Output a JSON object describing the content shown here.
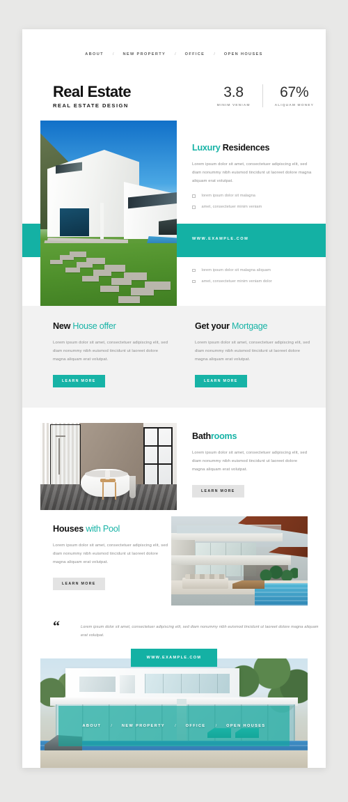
{
  "theme": {
    "accent": "#17b3a6",
    "accent_band": "#14b1a4",
    "page_bg": "#e8e8e7",
    "band_bg": "#f2f2f2",
    "text_dark": "#111111",
    "text_muted": "#8b8b8b"
  },
  "top_nav": {
    "items": [
      "ABOUT",
      "NEW PROPERTY",
      "OFFICE",
      "OPEN HOUSES"
    ],
    "separator": "/"
  },
  "brand": {
    "title": "Real Estate",
    "subtitle": "REAL ESTATE DESIGN"
  },
  "stats": [
    {
      "value": "3.8",
      "label": "MINIM VENIAM"
    },
    {
      "value": "67%",
      "label": "ALIQUAM MONEY"
    }
  ],
  "hero": {
    "heading_accent": "Luxury",
    "heading_rest": " Residences",
    "body": "Lorem ipsum dolor sit amet, consectetuer adipiscing elit, sed diam nonummy nibh euismod tincidunt ut laoreet dolore magna aliquam erat volutpat.",
    "bullets": [
      "lorem ipsum dolor sit malagna",
      "amet, consectetuer minim veniam"
    ],
    "image_alt": "modern-white-villa-with-lawn"
  },
  "teal_band": {
    "url": "WWW.EXAMPLE.COM"
  },
  "hero_list_2": {
    "bullets": [
      "lorem ipsum dolor sit malagna aliquam",
      "amet, consectetuer minim veniam dolor"
    ]
  },
  "offers": [
    {
      "heading_dark": "New",
      "heading_accent": " House offer",
      "body": "Lorem ipsum dolor sit amet, consectetuer adipiscing elit, sed diam nonummy nibh euismod tincidunt ut laoreet dolore magna aliquam erat volutpat.",
      "button": "LEARN MORE",
      "button_style": "teal"
    },
    {
      "heading_dark": "Get your",
      "heading_accent": " Mortgage",
      "body": "Lorem ipsum dolor sit amet, consectetuer adipiscing elit, sed diam nonummy nibh euismod tincidunt ut laoreet dolore magna aliquam erat volutpat.",
      "button": "LEARN MORE",
      "button_style": "teal"
    }
  ],
  "bathrooms": {
    "heading_dark": "Bath",
    "heading_accent": "rooms",
    "body": "Lorem ipsum dolor sit amet, consectetuer adipiscing elit, sed diam nonummy nibh euismod tincidunt ut laoreet dolore magna aliquam erat volutpat.",
    "button": "LEARN MORE",
    "image_alt": "minimal-bathroom-with-freestanding-tub"
  },
  "pool": {
    "heading_dark": "Houses",
    "heading_accent": " with Pool",
    "body": "Lorem ipsum dolor sit amet, consectetuer adipiscing elit, sed diam nonummy nibh euismod tincidunt ut laoreet dolore magna aliquam erat volutpat.",
    "button": "LEARN MORE",
    "image_alt": "luxury-terrace-with-pool"
  },
  "quote": {
    "mark": "“",
    "text": "Lorem ipsum dolor sit amet, consectetuer adipiscing elit, sed diam nonummy nibh euismod tincidunt ut laoreet dolore magna aliquam erat volutpat."
  },
  "footer": {
    "url_badge": "WWW.EXAMPLE.COM",
    "nav_items": [
      "ABOUT",
      "NEW PROPERTY",
      "OFFICE",
      "OPEN HOUSES"
    ],
    "separator": "/",
    "image_alt": "modern-glass-house-with-pool"
  }
}
